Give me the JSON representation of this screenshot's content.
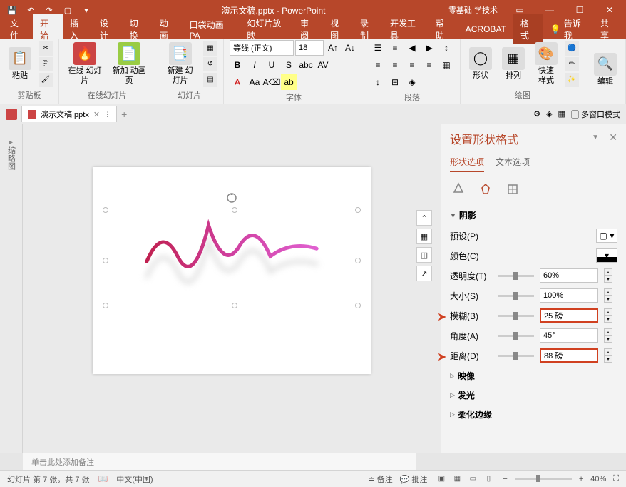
{
  "titlebar": {
    "title": "演示文稿.pptx - PowerPoint",
    "right_text": "零基础 学技术"
  },
  "tabs": {
    "file": "文件",
    "home": "开始",
    "insert": "插入",
    "design": "设计",
    "transitions": "切换",
    "animations": "动画",
    "pocket": "口袋动画 PA",
    "slideshow": "幻灯片放映",
    "review": "审阅",
    "view": "视图",
    "record": "录制",
    "developer": "开发工具",
    "help": "帮助",
    "acrobat": "ACROBAT",
    "format": "格式",
    "tellme": "告诉我",
    "share": "共享"
  },
  "ribbon": {
    "clipboard": {
      "label": "剪贴板",
      "paste": "粘贴"
    },
    "online": {
      "label": "在线幻灯片",
      "p1": "在线\n幻灯片",
      "p2": "新加\n动画页"
    },
    "slides": {
      "label": "幻灯片",
      "new": "新建\n幻灯片"
    },
    "font": {
      "label": "字体",
      "name": "等线 (正文)",
      "size": "18"
    },
    "paragraph": {
      "label": "段落"
    },
    "drawing": {
      "label": "绘图",
      "shape": "形状",
      "arrange": "排列",
      "quick": "快速样式"
    },
    "editing": {
      "label": "编辑"
    }
  },
  "doctab": {
    "name": "演示文稿.pptx",
    "multiwin": "多窗口模式"
  },
  "sidebar": {
    "label": "缩略图"
  },
  "pane": {
    "title": "设置形状格式",
    "shape_options": "形状选项",
    "text_options": "文本选项",
    "sections": {
      "shadow": "阴影",
      "reflection": "映像",
      "glow": "发光",
      "soft_edges": "柔化边缘"
    },
    "props": {
      "preset": "预设(P)",
      "color": "颜色(C)",
      "transparency": "透明度(T)",
      "transparency_val": "60%",
      "size": "大小(S)",
      "size_val": "100%",
      "blur": "模糊(B)",
      "blur_val": "25 磅",
      "angle": "角度(A)",
      "angle_val": "45°",
      "distance": "距离(D)",
      "distance_val": "88 磅"
    }
  },
  "notes": {
    "placeholder": "单击此处添加备注"
  },
  "statusbar": {
    "slide_info": "幻灯片 第 7 张，共 7 张",
    "language": "中文(中国)",
    "notes_btn": "备注",
    "comments_btn": "批注",
    "zoom": "40%"
  }
}
